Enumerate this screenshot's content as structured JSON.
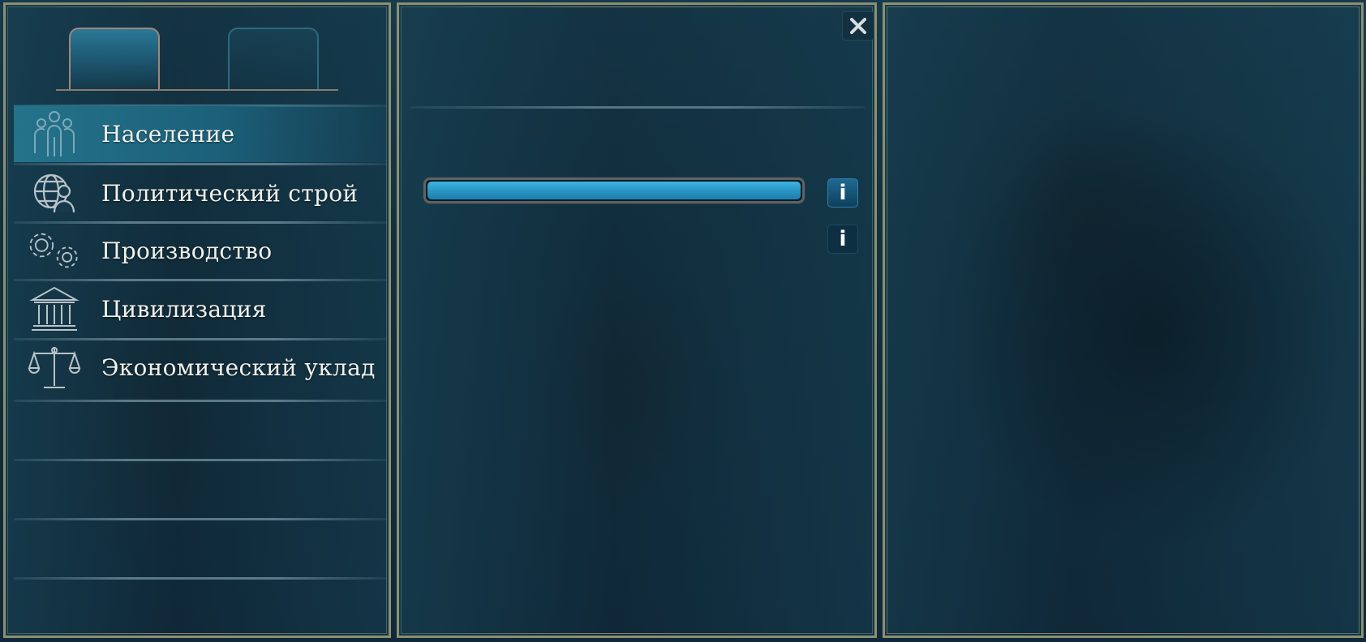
{
  "menu": {
    "items": [
      {
        "label": "Население",
        "icon": "population-icon",
        "active": true
      },
      {
        "label": "Политический строй",
        "icon": "globe-person-icon",
        "active": false
      },
      {
        "label": "Производство",
        "icon": "gears-icon",
        "active": false
      },
      {
        "label": "Цивилизация",
        "icon": "temple-icon",
        "active": false
      },
      {
        "label": "Экономический уклад",
        "icon": "scales-icon",
        "active": false
      }
    ]
  },
  "tabs": [
    {
      "active": true
    },
    {
      "active": false
    }
  ],
  "details": {
    "progress": 1.0,
    "info_glyph": "i"
  },
  "close_glyph": "✕",
  "colors": {
    "accent": "#2a96c4",
    "active_row": "#24738a",
    "frame": "#8d8f6f",
    "text": "#f2f2ec"
  }
}
